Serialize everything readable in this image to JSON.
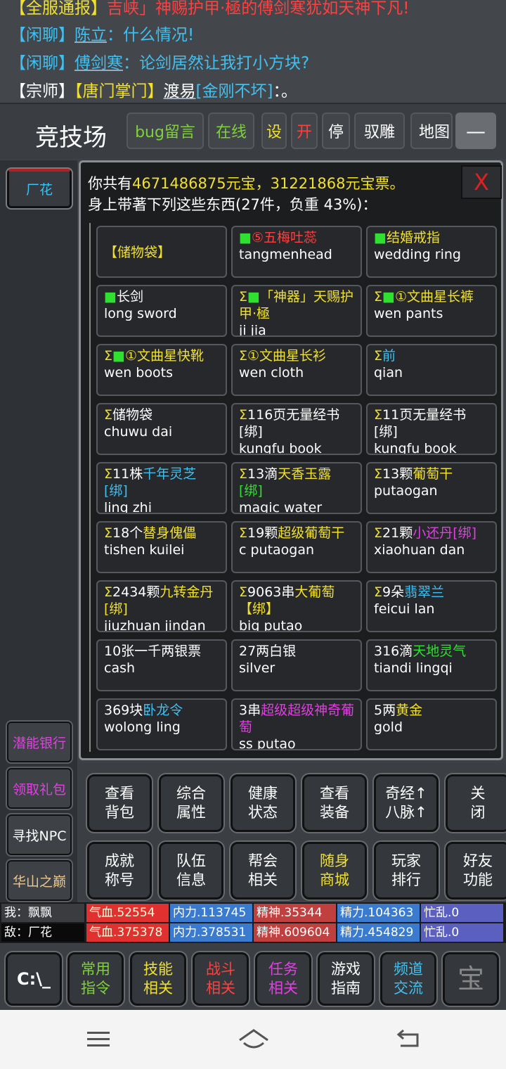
{
  "chat": [
    {
      "channel": "【全服通报】",
      "text": "吉峡」神赐护甲·極的傅剑寒犹如天神下凡!"
    },
    {
      "channel": "【闲聊】",
      "name": "陈立",
      "text": "：什么情况!"
    },
    {
      "channel": "【闲聊】",
      "name": "傅剑寒",
      "text": "：论剑居然让我打小方块?"
    },
    {
      "channel": "【宗师】",
      "sect": "【唐门掌门】",
      "name": "渡易",
      "title": "[金刚不坏]",
      "text": "：。"
    }
  ],
  "header": {
    "title": "竞技场",
    "buttons": [
      {
        "label": "bug留言",
        "color": "#7fd13b"
      },
      {
        "label": "在线",
        "color": "#7fd13b"
      },
      {
        "label": "设",
        "color": "#f0e030"
      },
      {
        "label": "开",
        "color": "#ff4040"
      },
      {
        "label": "停",
        "color": "#ffffff"
      },
      {
        "label": "驭雕",
        "color": "#ffffff"
      },
      {
        "label": "地图",
        "color": "#ffffff"
      },
      {
        "label": "—",
        "color": "#ffffff"
      }
    ]
  },
  "sidebar": {
    "target": "厂花",
    "items": [
      {
        "label": "潜能银行",
        "color": "#e040e0"
      },
      {
        "label": "领取礼包",
        "color": "#e040e0"
      },
      {
        "label": "寻找NPC",
        "color": "#ffffff"
      },
      {
        "label": "华山之巅",
        "color": "#e8c890"
      }
    ]
  },
  "inventory": {
    "line1_prefix": "你共有",
    "yuanbao": "4671486875",
    "yuanbao_unit": "元宝，",
    "yuanbao_piao": "31221868",
    "piao_unit": "元宝票。",
    "line2": "身上带著下列这些东西(27件，负重 43%)：",
    "close_label": "X",
    "items": [
      {
        "parts": [
          {
            "t": "【储物袋】",
            "c": "#f0e030"
          }
        ],
        "en": ""
      },
      {
        "parts": [
          {
            "t": "■",
            "c": "#30e030"
          },
          {
            "t": "⑤五梅吐蕊",
            "c": "#ff4040"
          }
        ],
        "en": "tangmenhead"
      },
      {
        "parts": [
          {
            "t": "■",
            "c": "#30e030"
          },
          {
            "t": "结婚戒指",
            "c": "#f0e030"
          }
        ],
        "en": "wedding ring"
      },
      {
        "parts": [
          {
            "t": "■",
            "c": "#30e030"
          },
          {
            "t": "长剑",
            "c": "#ffffff"
          }
        ],
        "en": "long sword"
      },
      {
        "parts": [
          {
            "t": "Σ",
            "c": "#f0e030"
          },
          {
            "t": "■",
            "c": "#30e030"
          },
          {
            "t": "「神器」天赐护甲·極",
            "c": "#f0e030"
          }
        ],
        "en": "ji jia"
      },
      {
        "parts": [
          {
            "t": "Σ",
            "c": "#f0e030"
          },
          {
            "t": "■",
            "c": "#30e030"
          },
          {
            "t": "①文曲星长裤",
            "c": "#f0e030"
          }
        ],
        "en": "wen pants"
      },
      {
        "parts": [
          {
            "t": "Σ",
            "c": "#f0e030"
          },
          {
            "t": "■",
            "c": "#30e030"
          },
          {
            "t": "①文曲星快靴",
            "c": "#f0e030"
          }
        ],
        "en": "wen boots"
      },
      {
        "parts": [
          {
            "t": "Σ",
            "c": "#f0e030"
          },
          {
            "t": "①文曲星长衫",
            "c": "#f0e030"
          }
        ],
        "en": "wen cloth"
      },
      {
        "parts": [
          {
            "t": "Σ",
            "c": "#f0e030"
          },
          {
            "t": "前",
            "c": "#40c0f0"
          }
        ],
        "en": "qian"
      },
      {
        "parts": [
          {
            "t": "Σ",
            "c": "#f0e030"
          },
          {
            "t": "储物袋",
            "c": "#ffffff"
          }
        ],
        "en": "chuwu dai"
      },
      {
        "parts": [
          {
            "t": "Σ",
            "c": "#f0e030"
          },
          {
            "t": "116页无量经书",
            "c": "#ffffff"
          }
        ],
        "sub": "[绑]",
        "en": "kungfu book"
      },
      {
        "parts": [
          {
            "t": "Σ",
            "c": "#f0e030"
          },
          {
            "t": "11页无量经书",
            "c": "#ffffff"
          }
        ],
        "sub": "[绑]",
        "en": "kungfu book"
      },
      {
        "parts": [
          {
            "t": "Σ",
            "c": "#f0e030"
          },
          {
            "t": "11株",
            "c": "#ffffff"
          },
          {
            "t": "千年灵芝",
            "c": "#40c0f0"
          }
        ],
        "sub": "[绑]",
        "subc": "#40c0f0",
        "en": "ling zhi"
      },
      {
        "parts": [
          {
            "t": "Σ",
            "c": "#f0e030"
          },
          {
            "t": "13滴",
            "c": "#ffffff"
          },
          {
            "t": "天香玉露",
            "c": "#f0e030"
          }
        ],
        "sub": "[绑]",
        "subc": "#30e030",
        "en": "magic water"
      },
      {
        "parts": [
          {
            "t": "Σ",
            "c": "#f0e030"
          },
          {
            "t": "13颗",
            "c": "#ffffff"
          },
          {
            "t": "葡萄干",
            "c": "#f0e030"
          }
        ],
        "en": "putaogan"
      },
      {
        "parts": [
          {
            "t": "Σ",
            "c": "#f0e030"
          },
          {
            "t": "18个",
            "c": "#ffffff"
          },
          {
            "t": "替身傀儡",
            "c": "#f0e030"
          }
        ],
        "en": "tishen kuilei"
      },
      {
        "parts": [
          {
            "t": "Σ",
            "c": "#f0e030"
          },
          {
            "t": "19颗",
            "c": "#ffffff"
          },
          {
            "t": "超级葡萄干",
            "c": "#f0e030"
          }
        ],
        "en": "c putaogan"
      },
      {
        "parts": [
          {
            "t": "Σ",
            "c": "#f0e030"
          },
          {
            "t": "21颗",
            "c": "#ffffff"
          },
          {
            "t": "小还丹[绑]",
            "c": "#e040e0"
          }
        ],
        "en": "xiaohuan dan"
      },
      {
        "parts": [
          {
            "t": "Σ",
            "c": "#f0e030"
          },
          {
            "t": "2434颗",
            "c": "#ffffff"
          },
          {
            "t": "九转金丹",
            "c": "#f0e030"
          }
        ],
        "sub": "[绑]",
        "subc": "#f0e030",
        "en": "jiuzhuan jindan"
      },
      {
        "parts": [
          {
            "t": "Σ",
            "c": "#f0e030"
          },
          {
            "t": "9063串",
            "c": "#ffffff"
          },
          {
            "t": "大葡萄",
            "c": "#f0e030"
          }
        ],
        "sub": "【绑】",
        "subc": "#f0e030",
        "en": "big putao"
      },
      {
        "parts": [
          {
            "t": "Σ",
            "c": "#f0e030"
          },
          {
            "t": "9朵",
            "c": "#ffffff"
          },
          {
            "t": "翡翠兰",
            "c": "#40c0f0"
          }
        ],
        "en": "feicui lan"
      },
      {
        "parts": [
          {
            "t": "10张一千两银票",
            "c": "#ffffff"
          }
        ],
        "en": "cash"
      },
      {
        "parts": [
          {
            "t": "27两白银",
            "c": "#ffffff"
          }
        ],
        "en": "silver"
      },
      {
        "parts": [
          {
            "t": "316滴",
            "c": "#ffffff"
          },
          {
            "t": "天地灵气",
            "c": "#30e030"
          }
        ],
        "en": "tiandi lingqi"
      },
      {
        "parts": [
          {
            "t": "369块",
            "c": "#ffffff"
          },
          {
            "t": "卧龙令",
            "c": "#40c0f0"
          }
        ],
        "en": "wolong ling"
      },
      {
        "parts": [
          {
            "t": "3串",
            "c": "#ffffff"
          },
          {
            "t": "超级超级神奇葡萄",
            "c": "#e040e0"
          }
        ],
        "en": "ss putao"
      },
      {
        "parts": [
          {
            "t": "5两",
            "c": "#ffffff"
          },
          {
            "t": "黄金",
            "c": "#f0e030"
          }
        ],
        "en": "gold"
      }
    ]
  },
  "actions": [
    {
      "label": "查看\n背包",
      "color": "#ffffff"
    },
    {
      "label": "综合\n属性",
      "color": "#ffffff"
    },
    {
      "label": "健康\n状态",
      "color": "#ffffff"
    },
    {
      "label": "查看\n装备",
      "color": "#ffffff"
    },
    {
      "label": "奇经↑\n八脉↑",
      "color": "#ffffff"
    },
    {
      "label": "关\n闭",
      "color": "#ffffff"
    },
    {
      "label": "成就\n称号",
      "color": "#ffffff"
    },
    {
      "label": "队伍\n信息",
      "color": "#ffffff"
    },
    {
      "label": "帮会\n相关",
      "color": "#ffffff"
    },
    {
      "label": "随身\n商城",
      "color": "#f0e030"
    },
    {
      "label": "玩家\n排行",
      "color": "#ffffff"
    },
    {
      "label": "好友\n功能",
      "color": "#ffffff"
    }
  ],
  "stats": {
    "me": {
      "label": "我：飘飘",
      "hp": "气血.52554",
      "neili": "内力.113745",
      "jingshen": "精神.35344",
      "jingli": "精力.104363",
      "mangluan": "忙乱.0"
    },
    "enemy": {
      "label": "敌：厂花",
      "hp": "气血.375378",
      "neili": "内力.378531",
      "jingshen": "精神.609604",
      "jingli": "精力.454829",
      "mangluan": "忙乱.0"
    }
  },
  "bottom": [
    {
      "label": "C:\\_",
      "color": "#ffffff"
    },
    {
      "label": "常用\n指令",
      "color": "#7fd13b"
    },
    {
      "label": "技能\n相关",
      "color": "#f0e030"
    },
    {
      "label": "战斗\n相关",
      "color": "#ff4040"
    },
    {
      "label": "任务\n相关",
      "color": "#e040e0"
    },
    {
      "label": "游戏\n指南",
      "color": "#ffffff"
    },
    {
      "label": "频道\n交流",
      "color": "#40c0f0"
    },
    {
      "label": "宝",
      "color": "#888888"
    }
  ]
}
